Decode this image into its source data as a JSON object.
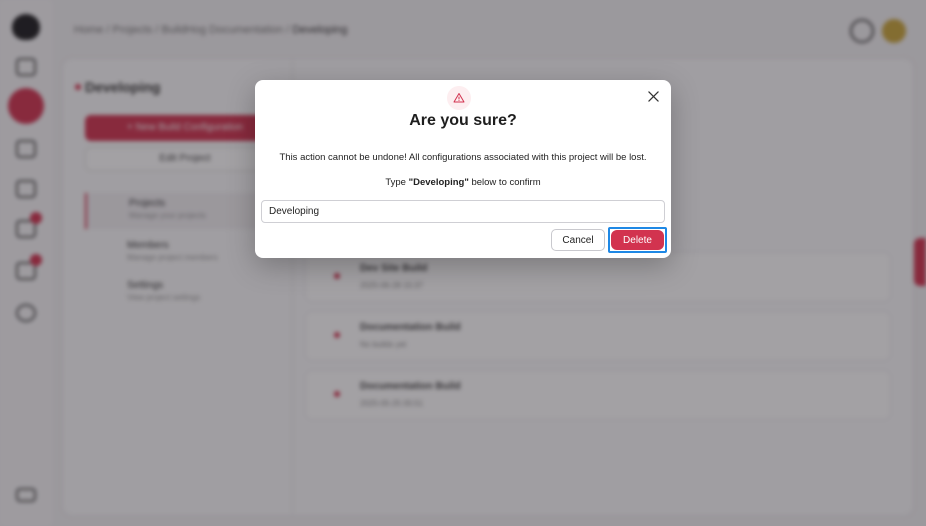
{
  "breadcrumb": {
    "home": "Home",
    "projects": "Projects",
    "project": "BuildHog Documentation",
    "current": "Developing",
    "separator": "/"
  },
  "sidebar": {
    "project_title": "Developing",
    "new_button": "+ New Build Configuration",
    "edit_button": "Edit Project",
    "nav": [
      {
        "label": "Projects",
        "sub": "Manage your projects"
      },
      {
        "label": "Members",
        "sub": "Manage project members"
      },
      {
        "label": "Settings",
        "sub": "View project settings"
      }
    ]
  },
  "builds": [
    {
      "title": "Dev Site Build",
      "meta": "2025-06-28 15:37"
    },
    {
      "title": "Documentation Build",
      "meta": "No builds yet"
    },
    {
      "title": "Documentation Build",
      "meta": "2025-05-25 05:51"
    }
  ],
  "modal": {
    "icon": "warning-triangle-icon",
    "title": "Are you sure?",
    "message": "This action cannot be undone! All configurations associated with this project will be lost.",
    "confirm_prefix": "Type ",
    "confirm_name": "\"Developing\"",
    "confirm_suffix": " below to confirm",
    "input_value": "Developing",
    "cancel_label": "Cancel",
    "delete_label": "Delete"
  },
  "colors": {
    "accent": "#d2334f",
    "focus": "#1e88e5"
  }
}
